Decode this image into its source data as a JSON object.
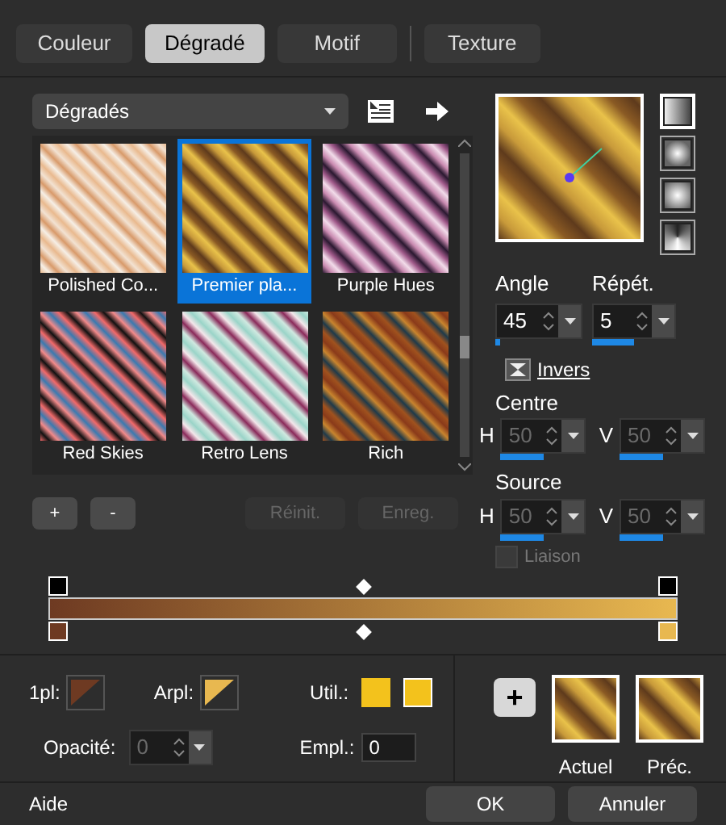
{
  "tabs": [
    {
      "label": "Couleur",
      "selected": false
    },
    {
      "label": "Dégradé",
      "selected": true
    },
    {
      "label": "Motif",
      "selected": false
    },
    {
      "label": "Texture",
      "selected": false
    }
  ],
  "gradient_select": {
    "value": "Dégradés"
  },
  "presets": [
    {
      "name": "Polished Co...",
      "selected": false
    },
    {
      "name": "Premier pla...",
      "selected": true
    },
    {
      "name": "Purple Hues",
      "selected": false
    },
    {
      "name": "Red Skies",
      "selected": false
    },
    {
      "name": "Retro Lens",
      "selected": false
    },
    {
      "name": "Rich",
      "selected": false
    }
  ],
  "styles": [
    {
      "kind": "linear",
      "selected": true
    },
    {
      "kind": "rectangular",
      "selected": false
    },
    {
      "kind": "radial",
      "selected": false
    },
    {
      "kind": "sunburst",
      "selected": false
    }
  ],
  "angle": {
    "label": "Angle",
    "value": "45",
    "level": 0.06
  },
  "repeat": {
    "label": "Répét.",
    "value": "5",
    "level": 0.5
  },
  "invert": {
    "label": "Invers"
  },
  "center": {
    "label": "Centre",
    "h": {
      "label": "H",
      "value": "50",
      "level": 0.5,
      "disabled": true
    },
    "v": {
      "label": "V",
      "value": "50",
      "level": 0.5,
      "disabled": true
    }
  },
  "source": {
    "label": "Source",
    "h": {
      "label": "H",
      "value": "50",
      "level": 0.5,
      "disabled": true
    },
    "v": {
      "label": "V",
      "value": "50",
      "level": 0.5,
      "disabled": true
    }
  },
  "link": {
    "label": "Liaison",
    "checked": false,
    "disabled": true
  },
  "preset_buttons": [
    {
      "label": "+",
      "disabled": false
    },
    {
      "label": "-",
      "disabled": false
    },
    {
      "label": "Réinit.",
      "disabled": true
    },
    {
      "label": "Enreg.",
      "disabled": true
    }
  ],
  "stops": [
    {
      "color": "#6e3a22"
    },
    {
      "color": "#e8b850"
    }
  ],
  "fg_label": "1pl:",
  "bg_label": "Arpl:",
  "user_label": "Util.:",
  "user_colors": [
    {
      "color": "#f3c21c"
    },
    {
      "color": "#f3c21c"
    }
  ],
  "opacity": {
    "label": "Opacité:",
    "value": "0",
    "disabled": true
  },
  "location": {
    "label": "Empl.:",
    "value": "0"
  },
  "add_button": "+",
  "current_label": "Actuel",
  "previous_label": "Préc.",
  "buttons": {
    "help": "Aide",
    "ok": "OK",
    "cancel": "Annuler"
  }
}
